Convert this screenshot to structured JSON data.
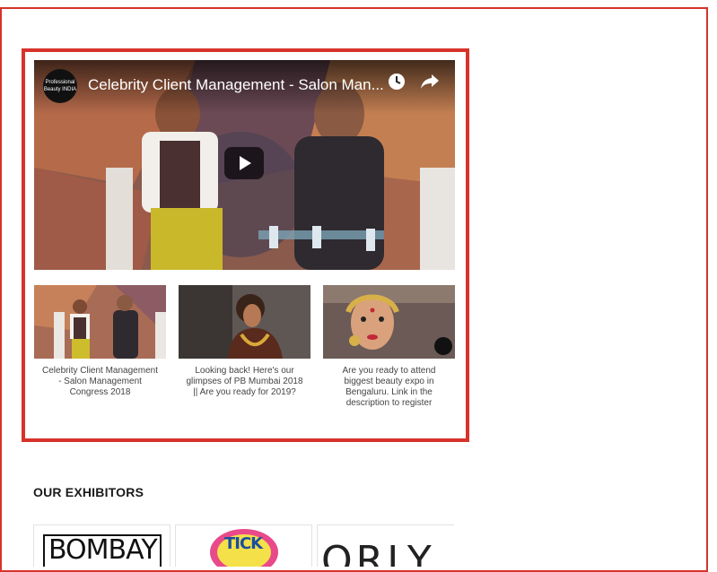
{
  "video_player": {
    "title": "Celebrity Client Management - Salon Man...",
    "channel_logo_text": "Professional Beauty INDIA",
    "icons": [
      "watch-later-icon",
      "share-icon",
      "play-icon"
    ]
  },
  "playlist": [
    {
      "caption": "Celebrity Client Management - Salon Management Congress 2018"
    },
    {
      "caption": "Looking back! Here's our glimpses of PB Mumbai 2018 || Are you ready for 2019?"
    },
    {
      "caption": "Are you ready to attend biggest beauty expo in Bengaluru. Link in the description to register"
    }
  ],
  "exhibitors": {
    "heading": "OUR EXHIBITORS",
    "logos": [
      "BOMBAY",
      "TICK",
      "ORLY"
    ]
  },
  "colors": {
    "accent_red": "#d7332b"
  }
}
